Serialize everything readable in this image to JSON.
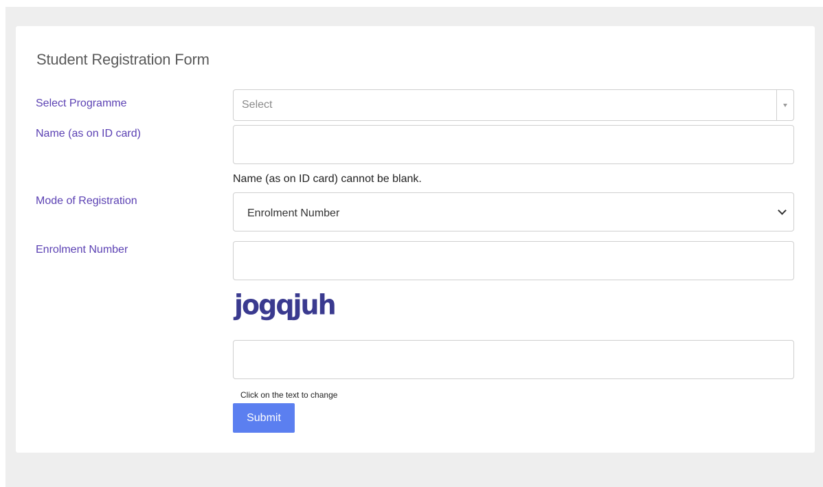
{
  "form": {
    "title": "Student Registration Form",
    "programme": {
      "label": "Select Programme",
      "placeholder": "Select"
    },
    "name": {
      "label": "Name (as on ID card)",
      "value": "",
      "error": "Name (as on ID card) cannot be blank."
    },
    "mode": {
      "label": "Mode of Registration",
      "selected": "Enrolment Number"
    },
    "enrolment": {
      "label": "Enrolment Number",
      "value": ""
    },
    "captcha": {
      "text": "jogqjuh",
      "input_value": "",
      "hint": "Click on the text to change"
    },
    "submit_label": "Submit"
  },
  "colors": {
    "label": "#5b41b3",
    "button": "#5b7ff0",
    "captcha": "#3a3a8f",
    "background": "#eeeeee"
  }
}
